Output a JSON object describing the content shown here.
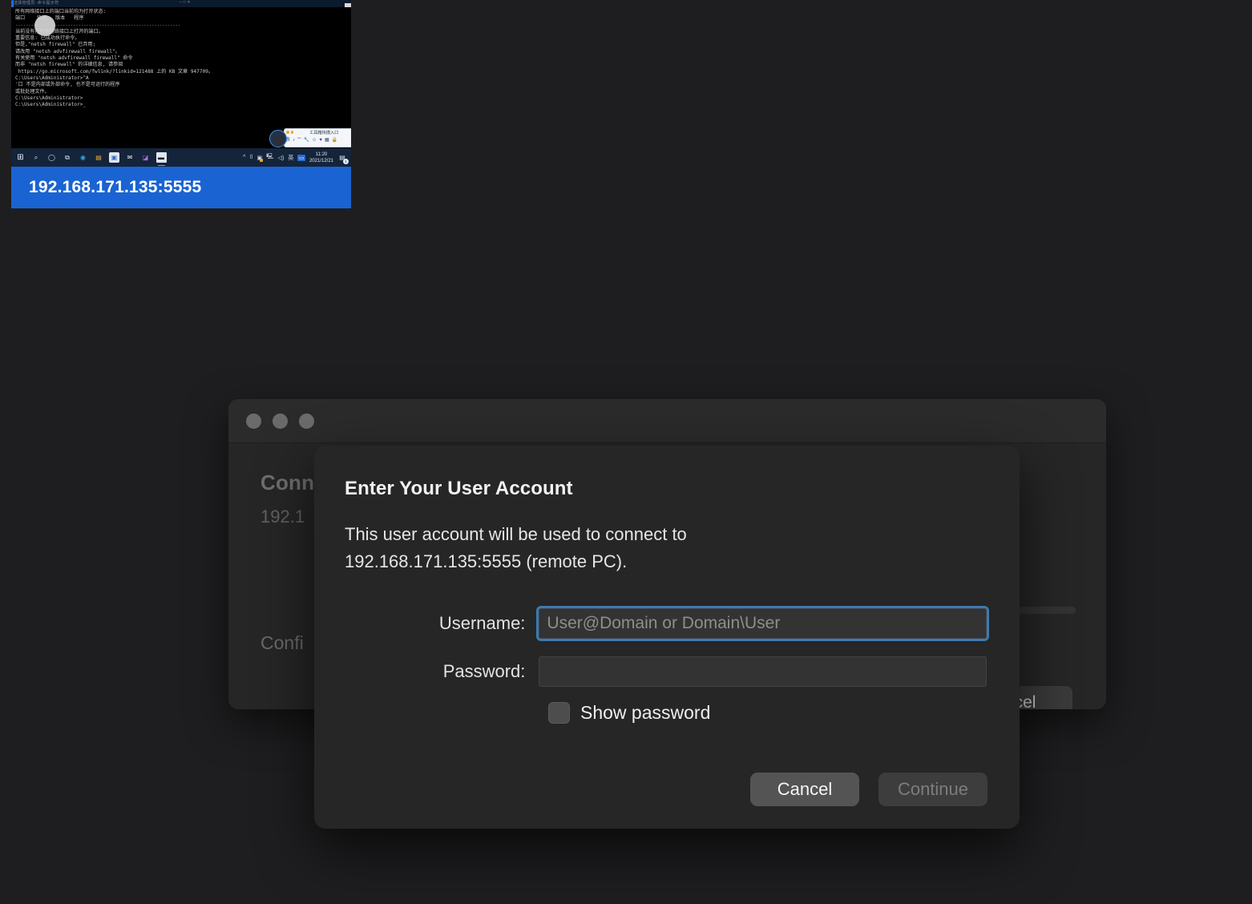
{
  "thumbnail": {
    "label": "192.168.171.135:5555",
    "window_title_left": "选择管理员: 命令提示符",
    "window_title_mid": "─  □  ✕",
    "console_lines": [
      "所有网络接口上的端口当前均为打开状态:",
      "端口    协议   版本   程序",
      "---------------------------------------------------------------",
      "当前没有在所有网络接口上打开的端口。",
      "",
      "重要信息: 已成功执行命令。",
      "但是,\"netsh firewall\" 已弃用;",
      "请改用 \"netsh advfirewall firewall\"。",
      "有关使用 \"netsh advfirewall firewall\" 命令",
      "而非 \"netsh firewall\" 的详细信息, 请参阅",
      " https://go.microsoft.com/fwlink/?linkid=121488 上的 KB 文章 947709。",
      "",
      "",
      "C:\\Users\\Administrator>^A",
      "'口 不是内部或外部命令, 也不是可运行的程序",
      "或批处理文件。",
      "",
      "C:\\Users\\Administrator>",
      "C:\\Users\\Administrator>_"
    ],
    "float_widget": {
      "tooltip": "工具箱快捷入口",
      "close": "✕",
      "icons": [
        "表",
        "♪",
        "\"\"",
        "🔧",
        "☺",
        "♥",
        "▦",
        "🔒"
      ]
    },
    "taskbar": {
      "apps": [
        "start-icon",
        "search-icon",
        "task-view-icon",
        "widgets-icon",
        "edge-icon",
        "file-explorer-icon",
        "store-icon",
        "mail-icon",
        "notepad-icon",
        "terminal-icon"
      ],
      "tray": [
        "chevron-up-icon",
        "usb-icon",
        "display-icon",
        "network-icon",
        "volume-icon",
        "ime-indicator",
        "onedrive-icon"
      ],
      "ime": "英",
      "time": "11:20",
      "date": "2021/12/21",
      "notification_count": "1"
    }
  },
  "background_window": {
    "traffic_lights": [
      "close-button",
      "minimize-button",
      "maximize-button"
    ],
    "heading": "Conn",
    "subheading": "192.1",
    "confirm_text": "Confi",
    "cancel_label": "cel"
  },
  "dialog": {
    "title": "Enter Your User Account",
    "message": "This user account will be used to connect to 192.168.171.135:5555 (remote PC).",
    "username_label": "Username:",
    "username_value": "",
    "username_placeholder": "User@Domain or Domain\\User",
    "password_label": "Password:",
    "password_value": "",
    "password_placeholder": "",
    "show_password_label": "Show password",
    "show_password_checked": false,
    "cancel_label": "Cancel",
    "continue_label": "Continue",
    "continue_enabled": false
  },
  "colors": {
    "page_background": "#1e1e20",
    "dialog_background": "#262626",
    "accent_blue": "#1a63d2",
    "focus_ring": "#3d7ab0",
    "console_background": "#000000",
    "taskbar_background": "#14243a"
  }
}
